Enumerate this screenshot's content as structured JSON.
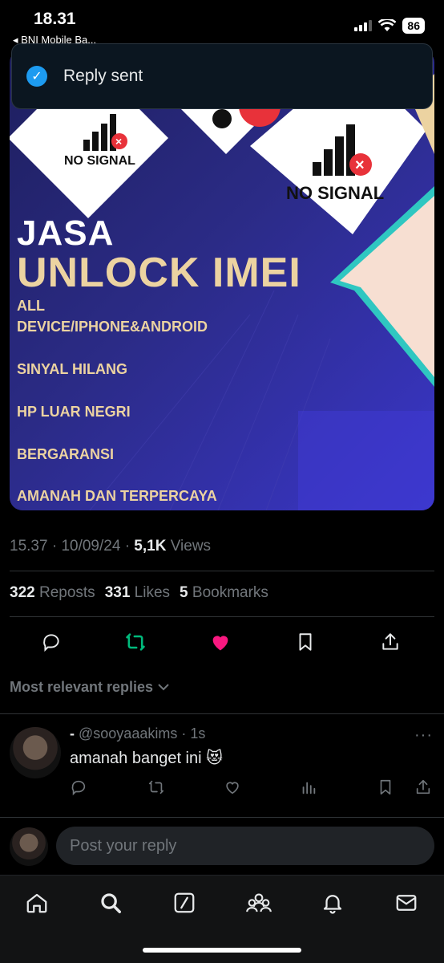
{
  "status_bar": {
    "time": "18.31",
    "back_app": "◂ BNI Mobile Ba...",
    "battery": "86"
  },
  "toast": {
    "text": "Reply sent"
  },
  "post_image": {
    "signal_small": "NO SIGNAL",
    "signal_large": "NO SIGNAL",
    "title": "JASA",
    "subtitle": "UNLOCK IMEI",
    "items": [
      "ALL",
      "DEVICE/IPHONE&ANDROID",
      "SINYAL HILANG",
      "HP LUAR NEGRI",
      "BERGARANSI",
      "AMANAH DAN TERPERCAYA"
    ]
  },
  "post_meta": {
    "time": "15.37",
    "date": "10/09/24",
    "views_count": "5,1K",
    "views_label": "Views",
    "sep": "·"
  },
  "stats": {
    "reposts_count": "322",
    "reposts_label": "Reposts",
    "likes_count": "331",
    "likes_label": "Likes",
    "bookmarks_count": "5",
    "bookmarks_label": "Bookmarks"
  },
  "colors": {
    "repost": "#00ba7c",
    "like": "#f91880",
    "accent": "#1d9bf0",
    "promo_gold": "#ecd3a1"
  },
  "replies_sort": {
    "label": "Most relevant replies"
  },
  "reply": {
    "name": "-",
    "handle": "@sooyaaakims",
    "time": "1s",
    "text": "amanah banget ini 😻",
    "more": "···"
  },
  "composer": {
    "placeholder": "Post your reply"
  },
  "tabs": [
    "home-icon",
    "search-icon",
    "grok-icon",
    "communities-icon",
    "notifications-icon",
    "messages-icon"
  ]
}
